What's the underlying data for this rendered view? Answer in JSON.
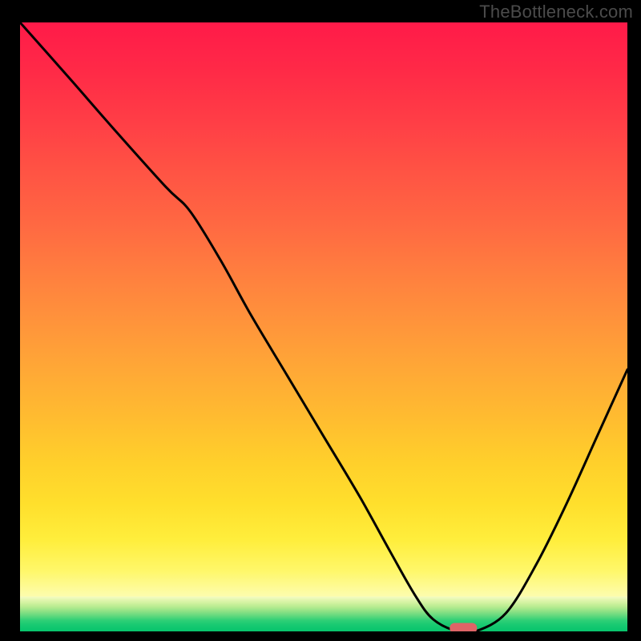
{
  "attribution": "TheBottleneck.com",
  "colors": {
    "frame": "#000000",
    "curve": "#000000",
    "marker": "#de6467",
    "gradient_top": "#ff1a49",
    "gradient_mid": "#ffdf2c",
    "gradient_bottom_band": "#07c46c"
  },
  "chart_data": {
    "type": "line",
    "title": "",
    "xlabel": "",
    "ylabel": "",
    "xlim": [
      0,
      100
    ],
    "ylim": [
      0,
      100
    ],
    "grid": false,
    "legend": false,
    "background": "vertical-rainbow-gradient red→orange→yellow→green",
    "series": [
      {
        "name": "bottleneck-curve",
        "x": [
          0,
          8,
          15,
          24,
          28,
          33,
          38,
          44,
          50,
          56,
          61,
          65,
          68,
          72,
          75,
          80,
          85,
          90,
          95,
          100
        ],
        "values": [
          100,
          91,
          83,
          73,
          69,
          61,
          52,
          42,
          32,
          22,
          13,
          6,
          2,
          0,
          0,
          3,
          11,
          21,
          32,
          43
        ]
      }
    ],
    "marker": {
      "name": "optimal-point",
      "x": 73,
      "y": 0,
      "shape": "rounded-bar"
    },
    "note": "Axis tick labels are not rendered in the image; values are read as fractions of plot width/height."
  }
}
